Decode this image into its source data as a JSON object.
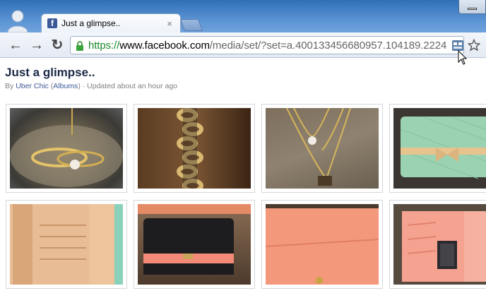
{
  "browser": {
    "tab": {
      "title": "Just a glimpse..",
      "close_glyph": "×"
    },
    "nav": {
      "back_glyph": "←",
      "forward_glyph": "→",
      "reload_glyph": "↻"
    },
    "url": {
      "scheme": "https://",
      "host": "www.facebook.com",
      "path": "/media/set/?set=a.400133456680957.104189.2224"
    }
  },
  "page": {
    "title": "Just a glimpse..",
    "meta": {
      "by": "By",
      "author": "Uber Chic",
      "album_link": "Albums",
      "separator": "·",
      "updated": "Updated about an hour ago"
    }
  },
  "photos": [
    {
      "name": "photo-jewelry-tray",
      "desc_icon": "gold-bracelets-on-tray"
    },
    {
      "name": "photo-chain-necklace",
      "desc_icon": "gold-chain"
    },
    {
      "name": "photo-pearl-necklace",
      "desc_icon": "layered-necklace"
    },
    {
      "name": "photo-mint-wallet",
      "desc_icon": "mint-wallet-with-bow"
    },
    {
      "name": "photo-open-wallet-peach",
      "desc_icon": "open-wallet-card-slots"
    },
    {
      "name": "photo-black-clutch",
      "desc_icon": "black-croc-wallet"
    },
    {
      "name": "photo-pink-wallet-flat",
      "desc_icon": "pink-wallet-open"
    },
    {
      "name": "photo-pink-wallet-slots",
      "desc_icon": "pink-wallet-id-window"
    }
  ],
  "colors": {
    "facebook_blue": "#3b5998",
    "https_green": "#1a8a2a",
    "title_dark": "#1c2a47"
  }
}
